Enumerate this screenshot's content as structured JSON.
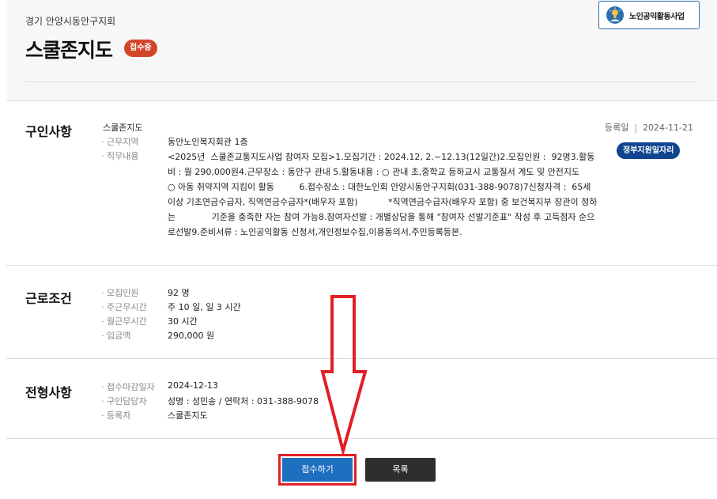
{
  "header": {
    "org_name": "경기 안양시동안구지회",
    "title": "스쿨존지도",
    "status": "접수중",
    "program_button": "노인공익활동사업",
    "program_icon": "bulb-person-icon"
  },
  "recruit": {
    "section_title": "구인사항",
    "company": "스쿨존지도",
    "rows": [
      {
        "label": "· 근무지역",
        "value": "동안노인복지회관 1층"
      },
      {
        "label": "· 직무내용",
        "value": "<2025년  스쿨존교통지도사업 참여자 모집>1.모집기간 : 2024.12, 2.~12.13(12일간)2.모집인원 :  92명3.활동 비 : 월 290,000원4.근무장소 : 동안구 관내 5.활동내용 : ○ 관내 초,중학교 등하교시 교통질서 계도 및 안전지도              ○ 아동 취약지역 지킴이 활동         6.접수장소 : 대한노인회 안양시동안구지회(031-388-9078)7신청자격 :  65세 이상 기초연금수급자, 직역연금수급자*(배우자 포함)           *직역연금수급자(배우자 포함) 중 보건복지부 장관이 정하는             기준을 충족한 자는 참여 가능8.참여자선발 : 개별상담을 통해 \"참여자 선발기준표\" 작성 후 고득점자 순으로선발9.준비서류 : 노인공익활동 신청서,개인정보수집,이용동의서,주민등록등본."
      }
    ],
    "reg_label": "등록일",
    "reg_sep": "|",
    "reg_date": "2024-11-21",
    "gov_badge": "정부지원일자리"
  },
  "conditions": {
    "section_title": "근로조건",
    "rows": [
      {
        "label": "· 모집인원",
        "value": "92 명"
      },
      {
        "label": "· 주근무시간",
        "value": "주 10 일, 일 3 시간"
      },
      {
        "label": "· 월근무시간",
        "value": "30 시간"
      },
      {
        "label": "· 임금액",
        "value": "290,000 원"
      }
    ]
  },
  "selection": {
    "section_title": "전형사항",
    "rows": [
      {
        "label": "· 접수마감일자",
        "value": "2024-12-13"
      },
      {
        "label": "· 구인담당자",
        "value": "성명 : 성민송 / 연락처 : 031-388-9078"
      },
      {
        "label": "· 등록자",
        "value": "스쿨존지도"
      }
    ]
  },
  "actions": {
    "apply": "접수하기",
    "list": "목록"
  },
  "colors": {
    "status_badge": "#d2452a",
    "gov_badge": "#11448f",
    "apply_button": "#1f6fc1",
    "list_button": "#2e2e2e",
    "annotation": "#e01f26"
  }
}
